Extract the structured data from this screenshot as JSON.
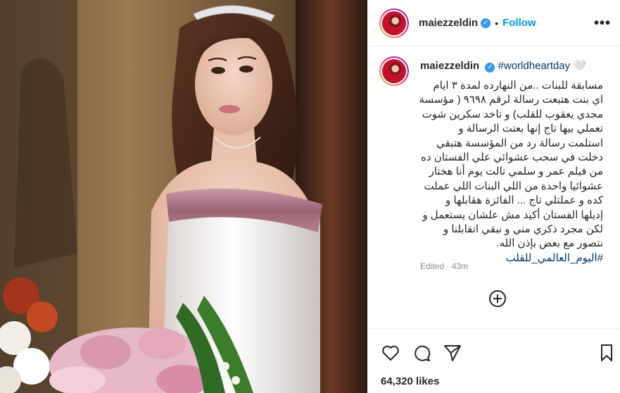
{
  "post": {
    "username": "maiezzeldin",
    "follow_label": "Follow",
    "hashtag_top": "#worldheartday",
    "emoji": "🤍",
    "caption_lines": [
      "مسابقة للبنات ..من النهارده لمدة ٣ ايام",
      "اي بنت هتبعت رسالة لرقم ٩٦٩٨ ( مؤسسة",
      "مجدي يعقوب للقلب) و تاخد سكرين شوت",
      "تعملي بيها تاج إنها بعتت الرسالة و",
      "استلمت رسالة رد من المؤسسة هتبقي",
      "دخلت في سحب عشوائي علي الفستان ده",
      "من فيلم عمر و سلمي تالت يوم أنا هختار",
      "عشوائيا واحدة من اللي البنات اللي عملت",
      "كده و عملتلي تاج ... الفائزة هقابلها و",
      "إديلها الفستان أكيد مش علشان يستعمل و",
      "لكن مجرد ذكري مني و نبقي اتقابلنا و",
      "نتصور مع بعض بإذن الله."
    ],
    "hashtag_bottom": "#اليوم_العالمي_للقلب",
    "edited_label": "Edited · 43m",
    "likes": "64,320 likes"
  },
  "icons": {
    "verified": "verified-badge-icon",
    "more": "more-options-icon",
    "add": "add-comment-icon",
    "like": "heart-icon",
    "comment": "comment-icon",
    "share": "share-icon",
    "save": "bookmark-icon"
  },
  "colors": {
    "link": "#0095f6",
    "hashtag": "#00376b",
    "muted": "#8e8e8e",
    "border": "#efefef"
  }
}
